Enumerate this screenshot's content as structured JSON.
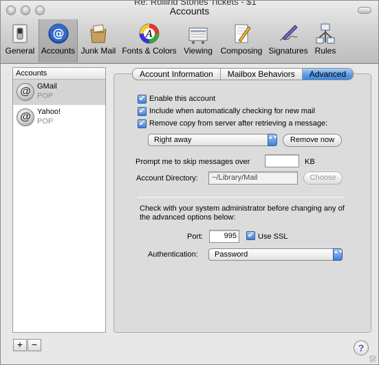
{
  "window": {
    "title": "Accounts",
    "behind_title": "Re: Rolling Stones Tickets - $1"
  },
  "toolbar": {
    "items": [
      {
        "label": "General",
        "icon": "switch-icon"
      },
      {
        "label": "Accounts",
        "icon": "at-sign-icon"
      },
      {
        "label": "Junk Mail",
        "icon": "junk-mail-icon"
      },
      {
        "label": "Fonts & Colors",
        "icon": "color-wheel-icon"
      },
      {
        "label": "Viewing",
        "icon": "viewing-icon"
      },
      {
        "label": "Composing",
        "icon": "pencil-paper-icon"
      },
      {
        "label": "Signatures",
        "icon": "signature-pen-icon"
      },
      {
        "label": "Rules",
        "icon": "rules-icon"
      }
    ],
    "selected": "Accounts"
  },
  "sidebar": {
    "header": "Accounts",
    "accounts": [
      {
        "name": "GMail",
        "type": "POP",
        "selected": true
      },
      {
        "name": "Yahoo!",
        "type": "POP",
        "selected": false
      }
    ],
    "add_label": "+",
    "remove_label": "−"
  },
  "tabs": {
    "items": [
      "Account Information",
      "Mailbox Behaviors",
      "Advanced"
    ],
    "active": "Advanced"
  },
  "advanced": {
    "enable_account": {
      "label": "Enable this account",
      "checked": true
    },
    "include_checking": {
      "label": "Include when automatically checking for new mail",
      "checked": true
    },
    "remove_copy": {
      "label": "Remove copy from server after retrieving a message:",
      "checked": true
    },
    "remove_when": {
      "value": "Right away",
      "arrows": "▲▼"
    },
    "remove_now_label": "Remove now",
    "skip_prompt": {
      "label": "Prompt me to skip messages over",
      "value": "",
      "unit": "KB"
    },
    "account_directory": {
      "label": "Account Directory:",
      "value": "~/Library/Mail",
      "choose_label": "Choose"
    },
    "admin_note": "Check with your system administrator before changing any of the advanced options below:",
    "port": {
      "label": "Port:",
      "value": "995"
    },
    "use_ssl": {
      "label": "Use SSL",
      "checked": true
    },
    "authentication": {
      "label": "Authentication:",
      "value": "Password",
      "arrows": "▲▼"
    }
  },
  "help_label": "?",
  "checkmark": "✔",
  "at_glyph": "@"
}
